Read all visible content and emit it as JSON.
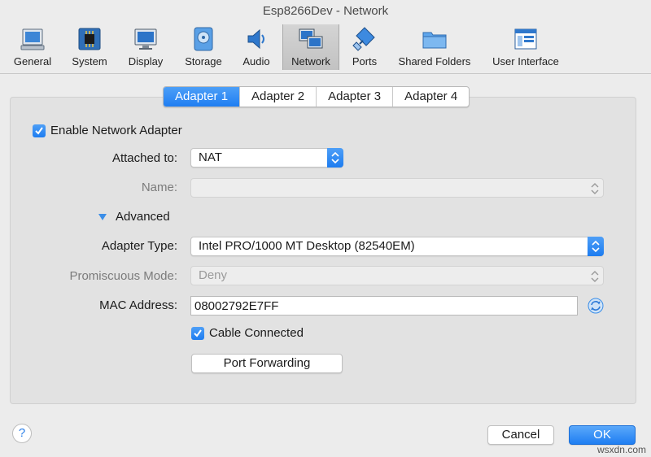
{
  "window": {
    "title": "Esp8266Dev - Network"
  },
  "toolbar": {
    "items": [
      {
        "label": "General",
        "icon": "general-icon"
      },
      {
        "label": "System",
        "icon": "system-icon"
      },
      {
        "label": "Display",
        "icon": "display-icon"
      },
      {
        "label": "Storage",
        "icon": "storage-icon"
      },
      {
        "label": "Audio",
        "icon": "audio-icon"
      },
      {
        "label": "Network",
        "icon": "network-icon",
        "active": true
      },
      {
        "label": "Ports",
        "icon": "ports-icon"
      },
      {
        "label": "Shared Folders",
        "icon": "folder-icon"
      },
      {
        "label": "User Interface",
        "icon": "user-interface-icon"
      }
    ]
  },
  "tabs": [
    {
      "label": "Adapter 1",
      "active": true
    },
    {
      "label": "Adapter 2"
    },
    {
      "label": "Adapter 3"
    },
    {
      "label": "Adapter 4"
    }
  ],
  "form": {
    "enable_label": "Enable Network Adapter",
    "enable_checked": true,
    "attached_label": "Attached to:",
    "attached_value": "NAT",
    "name_label": "Name:",
    "name_value": "",
    "advanced_label": "Advanced",
    "adapter_type_label": "Adapter Type:",
    "adapter_type_value": "Intel PRO/1000 MT Desktop (82540EM)",
    "promiscuous_label": "Promiscuous Mode:",
    "promiscuous_value": "Deny",
    "mac_label": "MAC Address:",
    "mac_value": "08002792E7FF",
    "cable_label": "Cable Connected",
    "cable_checked": true,
    "port_forwarding_label": "Port Forwarding"
  },
  "footer": {
    "help_label": "?",
    "cancel_label": "Cancel",
    "ok_label": "OK"
  },
  "watermark": "wsxdn.com",
  "colors": {
    "accent": "#1f7ef2",
    "panel": "#e2e2e2",
    "window": "#ececec"
  }
}
